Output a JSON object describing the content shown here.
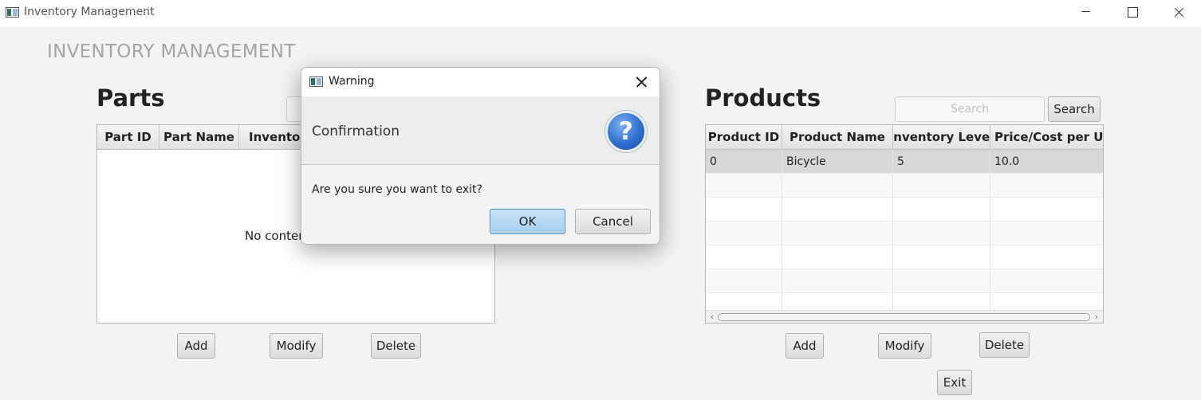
{
  "window": {
    "title": "Inventory Management",
    "icon": "app-window-icon"
  },
  "app_heading": "INVENTORY MANAGEMENT",
  "parts": {
    "title": "Parts",
    "columns": [
      "Part ID",
      "Part Name",
      "Inventory"
    ],
    "empty_text": "No content in table",
    "buttons": {
      "add": "Add",
      "modify": "Modify",
      "delete": "Delete"
    }
  },
  "products": {
    "title": "Products",
    "search_placeholder": "Search",
    "search_button": "Search",
    "columns": [
      "Product ID",
      "Product Name",
      "Inventory Level",
      "Price/Cost per Unit"
    ],
    "rows": [
      [
        "0",
        "Bicycle",
        "5",
        "10.0"
      ]
    ],
    "buttons": {
      "add": "Add",
      "modify": "Modify",
      "delete": "Delete"
    }
  },
  "exit_button": "Exit",
  "dialog": {
    "title": "Warning",
    "header": "Confirmation",
    "message": "Are you sure you want to exit?",
    "ok": "OK",
    "cancel": "Cancel",
    "icon": "question-icon",
    "ok_color": "#a5cdee"
  }
}
